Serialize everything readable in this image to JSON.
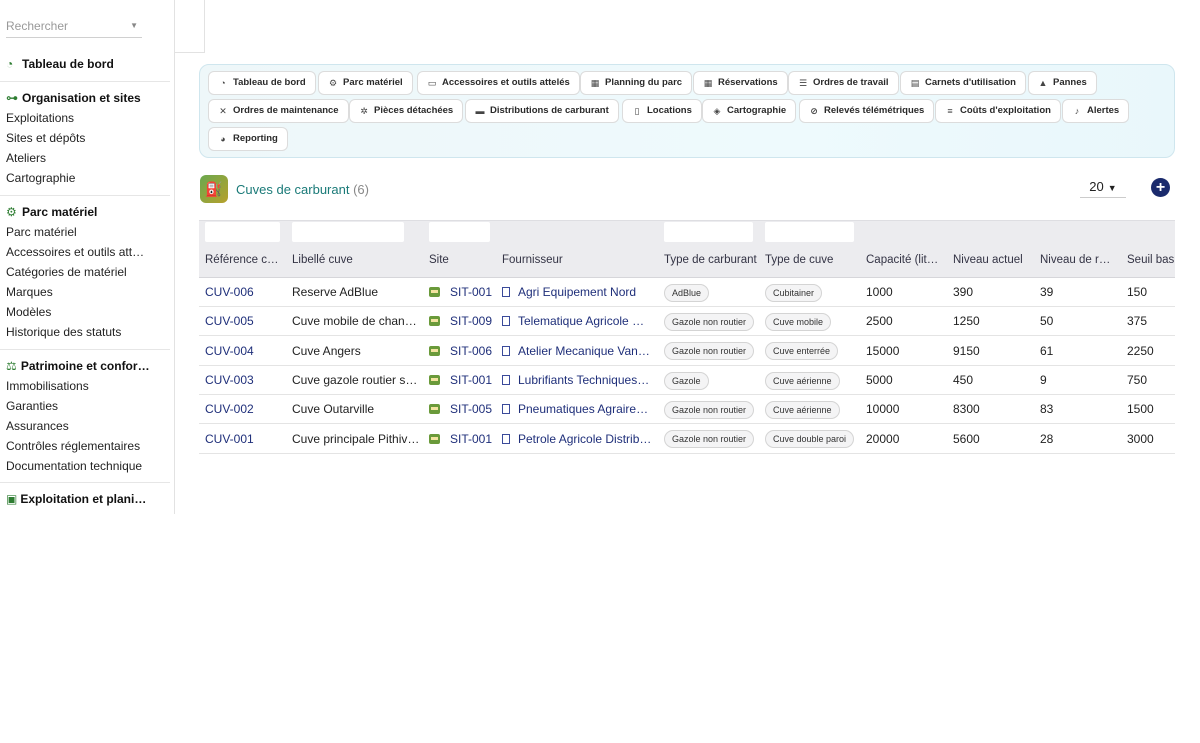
{
  "search": {
    "placeholder": "Rechercher"
  },
  "sidebar": {
    "dashboard": "Tableau de bord",
    "groups": [
      {
        "title": "Organisation et sites",
        "items": [
          "Exploitations",
          "Sites et dépôts",
          "Ateliers",
          "Cartographie"
        ]
      },
      {
        "title": "Parc matériel",
        "items": [
          "Parc matériel",
          "Accessoires et outils attelés",
          "Catégories de matériel",
          "Marques",
          "Modèles",
          "Historique des statuts"
        ]
      },
      {
        "title": "Patrimoine et conformité",
        "items": [
          "Immobilisations",
          "Garanties",
          "Assurances",
          "Contrôles réglementaires",
          "Documentation technique"
        ]
      },
      {
        "title": "Exploitation et planification",
        "items": []
      }
    ]
  },
  "nav": {
    "chips": [
      {
        "label": "Tableau de bord",
        "icon": "gauge-icon"
      },
      {
        "label": "Parc matériel",
        "icon": "tractor-icon"
      },
      {
        "label": "Accessoires et outils attelés",
        "icon": "toolbox-icon"
      },
      {
        "label": "Planning du parc",
        "icon": "calendar-icon"
      },
      {
        "label": "Réservations",
        "icon": "calendar-check-icon"
      },
      {
        "label": "Ordres de travail",
        "icon": "list-icon"
      },
      {
        "label": "Carnets d'utilisation",
        "icon": "book-icon"
      },
      {
        "label": "Pannes",
        "icon": "warning-icon"
      },
      {
        "label": "Ordres de maintenance",
        "icon": "tools-icon"
      },
      {
        "label": "Pièces détachées",
        "icon": "gear-icon"
      },
      {
        "label": "Distributions de carburant",
        "icon": "truck-icon"
      },
      {
        "label": "Locations",
        "icon": "file-icon"
      },
      {
        "label": "Cartographie",
        "icon": "map-icon"
      },
      {
        "label": "Relevés télémétriques",
        "icon": "satellite-icon"
      },
      {
        "label": "Coûts d'exploitation",
        "icon": "coins-icon"
      },
      {
        "label": "Alertes",
        "icon": "bell-icon"
      },
      {
        "label": "Reporting",
        "icon": "chart-pie-icon"
      }
    ]
  },
  "page": {
    "title": "Cuves de carburant",
    "count": "(6)",
    "page_size": "20"
  },
  "table": {
    "columns": [
      "Référence cuve",
      "Libellé cuve",
      "Site",
      "Fournisseur",
      "Type de carburant",
      "Type de cuve",
      "Capacité (litres)",
      "Niveau actuel",
      "Niveau de remplissage",
      "Seuil bas"
    ],
    "rows": [
      {
        "ref": "CUV-006",
        "label": "Reserve AdBlue",
        "site": "SIT-001",
        "supplier": "Agri Equipement Nord",
        "fuel": "AdBlue",
        "tank": "Cubitainer",
        "capacity": "1000",
        "level": "390",
        "fill": "39",
        "low": "150"
      },
      {
        "ref": "CUV-005",
        "label": "Cuve mobile de chantier",
        "site": "SIT-009",
        "supplier": "Telematique Agricole Solutions",
        "fuel": "Gazole non routier",
        "tank": "Cuve mobile",
        "capacity": "2500",
        "level": "1250",
        "fill": "50",
        "low": "375"
      },
      {
        "ref": "CUV-004",
        "label": "Cuve Angers",
        "site": "SIT-006",
        "supplier": "Atelier Mecanique Vandeen",
        "fuel": "Gazole non routier",
        "tank": "Cuve enterrée",
        "capacity": "15000",
        "level": "9150",
        "fill": "61",
        "low": "2250"
      },
      {
        "ref": "CUV-003",
        "label": "Cuve gazole routier siege",
        "site": "SIT-001",
        "supplier": "Lubrifiants Techniques SA",
        "fuel": "Gazole",
        "tank": "Cuve aérienne",
        "capacity": "5000",
        "level": "450",
        "fill": "9",
        "low": "750"
      },
      {
        "ref": "CUV-002",
        "label": "Cuve Outarville",
        "site": "SIT-005",
        "supplier": "Pneumatiques Agraires Service",
        "fuel": "Gazole non routier",
        "tank": "Cuve aérienne",
        "capacity": "10000",
        "level": "8300",
        "fill": "83",
        "low": "1500"
      },
      {
        "ref": "CUV-001",
        "label": "Cuve principale Pithiviers",
        "site": "SIT-001",
        "supplier": "Petrole Agricole Distribution",
        "fuel": "Gazole non routier",
        "tank": "Cuve double paroi",
        "capacity": "20000",
        "level": "5600",
        "fill": "28",
        "low": "3000"
      }
    ]
  }
}
